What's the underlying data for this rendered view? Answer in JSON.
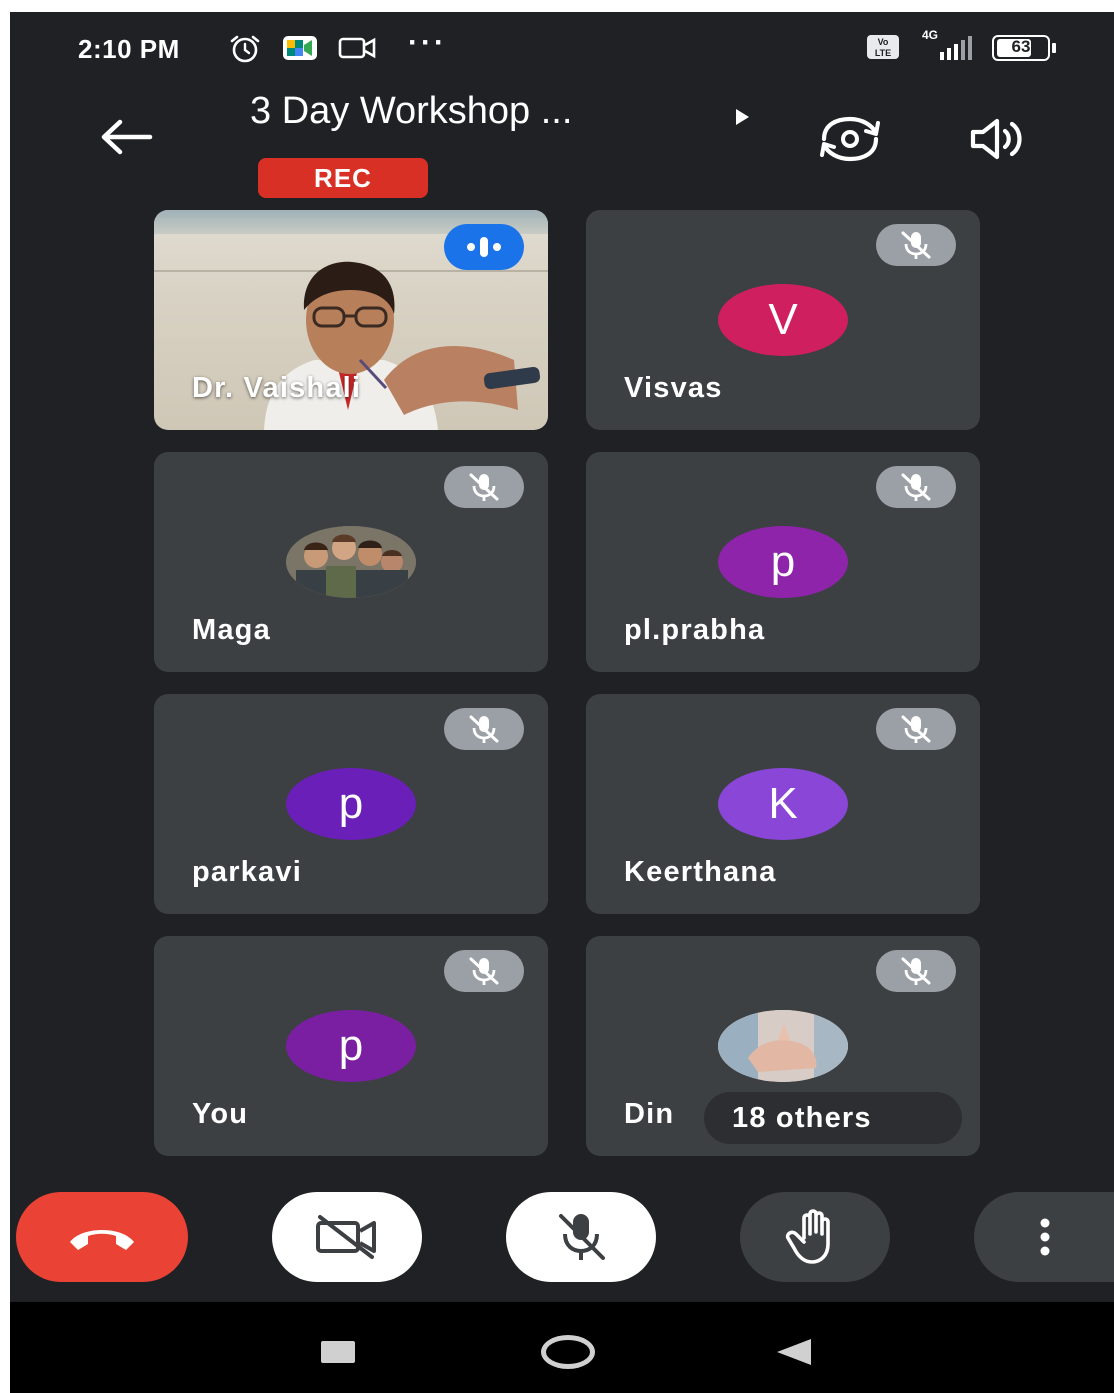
{
  "status_bar": {
    "time": "2:10 PM",
    "overflow": "···",
    "network": "4G",
    "battery": "63"
  },
  "header": {
    "title": "3 Day Workshop ...",
    "rec_label": "REC"
  },
  "participants": [
    {
      "name": "Dr. Vaishali",
      "kind": "video",
      "speaking": true
    },
    {
      "name": "Visvas",
      "initial": "V",
      "color": "#d01f5f",
      "muted": true
    },
    {
      "name": "Maga",
      "kind": "photo",
      "muted": true
    },
    {
      "name": "pl.prabha",
      "initial": "p",
      "color": "#8e24aa",
      "muted": true
    },
    {
      "name": "parkavi",
      "initial": "p",
      "color": "#6a1fb8",
      "muted": true
    },
    {
      "name": "Keerthana",
      "initial": "K",
      "color": "#8a46d6",
      "muted": true
    },
    {
      "name": "You",
      "initial": "p",
      "color": "#7b1fa2",
      "muted": true
    },
    {
      "name": "Din",
      "kind": "photo",
      "muted": true,
      "others_label": "18 others"
    }
  ],
  "controls": {
    "end_call_color": "#ea4335",
    "icons": [
      "end-call-icon",
      "camera-off-icon",
      "mic-off-icon",
      "raise-hand-icon",
      "more-options-icon"
    ]
  },
  "colors": {
    "background": "#202124",
    "tile": "#3c4043",
    "rec": "#d93025",
    "speaking": "#1a73e8"
  }
}
